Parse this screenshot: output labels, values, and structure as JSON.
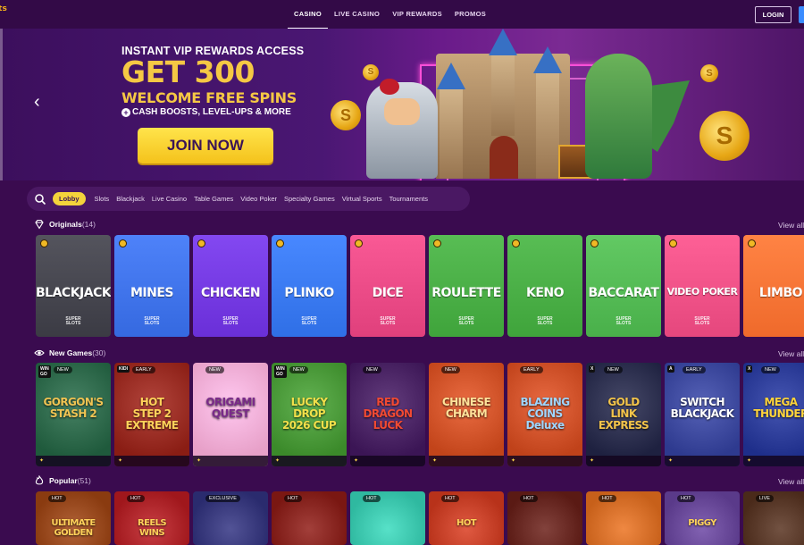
{
  "logo_text": "ots",
  "nav": {
    "links": [
      "CASINO",
      "LIVE CASINO",
      "VIP REWARDS",
      "PROMOS"
    ],
    "active": "CASINO",
    "login_label": "LOGIN"
  },
  "banner": {
    "line1": "INSTANT VIP REWARDS ACCESS",
    "line2": "GET 300",
    "line3": "WELCOME FREE SPINS",
    "line4": "CASH BOOSTS, LEVEL-UPS & MORE",
    "cta": "JOIN NOW",
    "prev_arrow": "‹"
  },
  "categories": [
    "Lobby",
    "Slots",
    "Blackjack",
    "Live Casino",
    "Table Games",
    "Video Poker",
    "Specialty Games",
    "Virtual Sports",
    "Tournaments"
  ],
  "sections": {
    "originals": {
      "title": "Originals",
      "count": "(14)",
      "view_all": "View all"
    },
    "new_games": {
      "title": "New Games",
      "count": "(30)",
      "view_all": "View all"
    },
    "popular": {
      "title": "Popular",
      "count": "(51)",
      "view_all": "View all"
    }
  },
  "originals": [
    {
      "name": "BLACKJACK",
      "brand": "SUPER\nSLOTS",
      "color": "#3b3b44"
    },
    {
      "name": "MINES",
      "brand": "SUPER\nSLOTS",
      "color": "#3569e0"
    },
    {
      "name": "CHICKEN",
      "brand": "SUPER\nSLOTS",
      "color": "#6a2fd8"
    },
    {
      "name": "PLINKO",
      "brand": "SUPER\nSLOTS",
      "color": "#2f6fe6"
    },
    {
      "name": "DICE",
      "brand": "SUPER\nSLOTS",
      "color": "#e0407c"
    },
    {
      "name": "ROULETTE",
      "brand": "SUPER\nSLOTS",
      "color": "#3fa43b"
    },
    {
      "name": "KENO",
      "brand": "SUPER\nSLOTS",
      "color": "#3fa43b"
    },
    {
      "name": "BACCARAT",
      "brand": "SUPER\nSLOTS",
      "color": "#49b04a"
    },
    {
      "name": "VIDEO POKER",
      "brand": "SUPER\nSLOTS",
      "color": "#e5477d"
    },
    {
      "name": "LIMBO",
      "brand": "",
      "color": "#ef6a2b"
    }
  ],
  "new_games": [
    {
      "title": "GORGON'S\nSTASH 2",
      "badge": "NEW",
      "provider": "WIN\nGO",
      "bg": "#1f5a3c",
      "color": "#f0c453"
    },
    {
      "title": "HOT\nSTEP 2\nEXTREME",
      "badge": "EARLY",
      "provider": "KIDI",
      "bg": "#8a1d14",
      "color": "#ffd25a"
    },
    {
      "title": "ORIGAMI\nQUEST",
      "badge": "NEW",
      "provider": "",
      "bg": "#e7a0c8",
      "color": "#7a2a8a"
    },
    {
      "title": "LUCKY\nDROP\n2026 CUP",
      "badge": "NEW",
      "provider": "WIN\nGO",
      "bg": "#3b8a2a",
      "color": "#f2e04a"
    },
    {
      "title": "RED\nDRAGON\nLUCK",
      "badge": "NEW",
      "provider": "",
      "bg": "#3b1555",
      "color": "#f14a33"
    },
    {
      "title": "CHINESE\nCHARM",
      "badge": "NEW",
      "provider": "",
      "bg": "#c2441a",
      "color": "#ffe29a"
    },
    {
      "title": "BLAZING\nCOINS\nDeluxe",
      "badge": "EARLY",
      "provider": "",
      "bg": "#c0421a",
      "color": "#9fd6ff"
    },
    {
      "title": "GOLD\nLINK\nEXPRESS",
      "badge": "NEW",
      "provider": "X",
      "bg": "#1e2140",
      "color": "#f3c44a"
    },
    {
      "title": "SWITCH\nBLACKJACK",
      "badge": "EARLY",
      "provider": "A",
      "bg": "#2e3a8f",
      "color": "#ffffff"
    },
    {
      "title": "MEGA\nTHUNDER",
      "badge": "NEW",
      "provider": "X",
      "bg": "#1e2e8a",
      "color": "#ffd43b"
    }
  ],
  "popular": [
    {
      "title": "ULTIMATE\nGOLDEN",
      "badge": "HOT",
      "bg": "#8a3b10"
    },
    {
      "title": "REELS\nWINS",
      "badge": "HOT",
      "bg": "#a0171c"
    },
    {
      "title": "",
      "badge": "EXCLUSIVE",
      "bg": "#2a2b6e"
    },
    {
      "title": "",
      "badge": "HOT",
      "bg": "#7a1712"
    },
    {
      "title": "",
      "badge": "HOT",
      "bg": "#2fb9a0"
    },
    {
      "title": "HOT",
      "badge": "HOT",
      "bg": "#b8321a"
    },
    {
      "title": "",
      "badge": "HOT",
      "bg": "#5a1a14"
    },
    {
      "title": "",
      "badge": "HOT",
      "bg": "#c7601a"
    },
    {
      "title": "PIGGY",
      "badge": "HOT",
      "bg": "#5a3a8a"
    },
    {
      "title": "",
      "badge": "LIVE",
      "bg": "#4a2a1a"
    }
  ],
  "colors": {
    "accent": "#f4d33b",
    "bg": "#3a0b4f"
  }
}
